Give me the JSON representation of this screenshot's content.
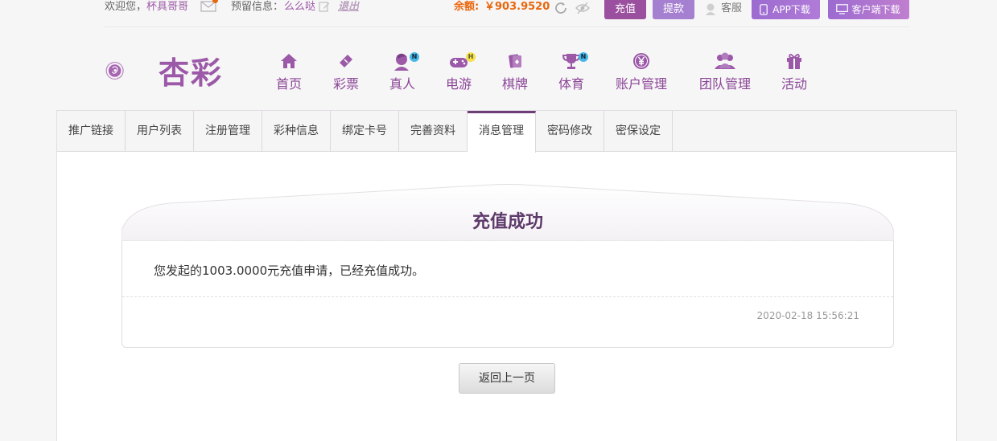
{
  "topbar": {
    "welcome": "欢迎您，",
    "username": "杯具哥哥",
    "reserve_label": "预留信息：",
    "reserve_value": "么么哒",
    "logout": "退出",
    "balance_label": "余额:",
    "balance_value": "￥903.9520",
    "charge": "充值",
    "withdraw": "提款",
    "customer_service": "客服",
    "app_download": "APP下载",
    "client_download": "客户端下载"
  },
  "logo": {
    "text": "杏彩"
  },
  "nav": [
    {
      "label": "首页",
      "icon": "home-icon"
    },
    {
      "label": "彩票",
      "icon": "lottery-ticket-icon"
    },
    {
      "label": "真人",
      "icon": "live-dealer-icon",
      "badge": "N"
    },
    {
      "label": "电游",
      "icon": "gamepad-icon",
      "badge": "H"
    },
    {
      "label": "棋牌",
      "icon": "cards-icon"
    },
    {
      "label": "体育",
      "icon": "trophy-icon",
      "badge": "N"
    },
    {
      "label": "账户管理",
      "icon": "yen-coin-icon"
    },
    {
      "label": "团队管理",
      "icon": "team-icon"
    },
    {
      "label": "活动",
      "icon": "gift-icon"
    }
  ],
  "tabs": [
    "推广链接",
    "用户列表",
    "注册管理",
    "彩种信息",
    "绑定卡号",
    "完善资料",
    "消息管理",
    "密码修改",
    "密保设定"
  ],
  "active_tab": "消息管理",
  "message": {
    "title": "充值成功",
    "body": "您发起的1003.0000元充值申请，已经充值成功。",
    "time": "2020-02-18 15:56:21"
  },
  "back_button": "返回上一页",
  "colors": {
    "brand": "#9b59a8",
    "accent_orange": "#e8670c",
    "tab_active": "#6d3f78"
  }
}
